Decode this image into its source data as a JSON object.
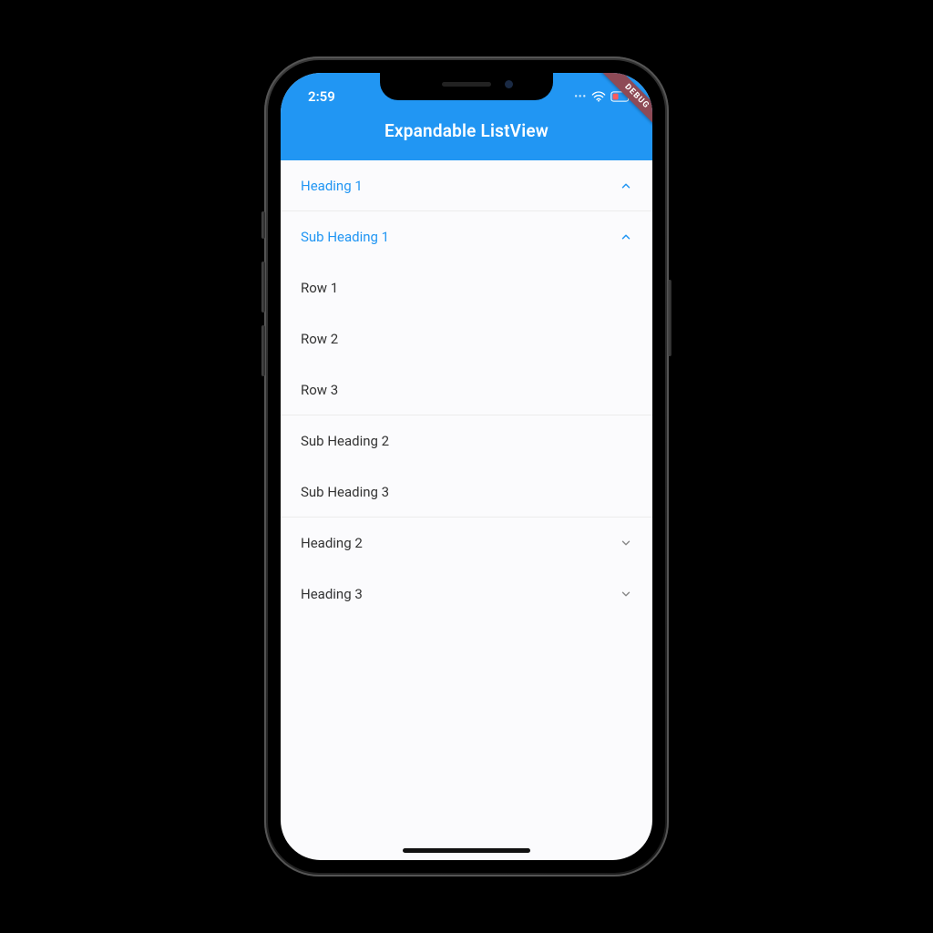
{
  "status": {
    "time": "2:59",
    "debug_label": "DEBUG"
  },
  "appbar": {
    "title": "Expandable ListView"
  },
  "colors": {
    "primary": "#2196f3"
  },
  "list": {
    "heading1": {
      "label": "Heading 1"
    },
    "sub_heading1": {
      "label": "Sub Heading 1"
    },
    "rows": [
      {
        "label": "Row 1"
      },
      {
        "label": "Row 2"
      },
      {
        "label": "Row 3"
      }
    ],
    "sub_heading2": {
      "label": "Sub Heading 2"
    },
    "sub_heading3": {
      "label": "Sub Heading 3"
    },
    "heading2": {
      "label": "Heading 2"
    },
    "heading3": {
      "label": "Heading 3"
    }
  }
}
